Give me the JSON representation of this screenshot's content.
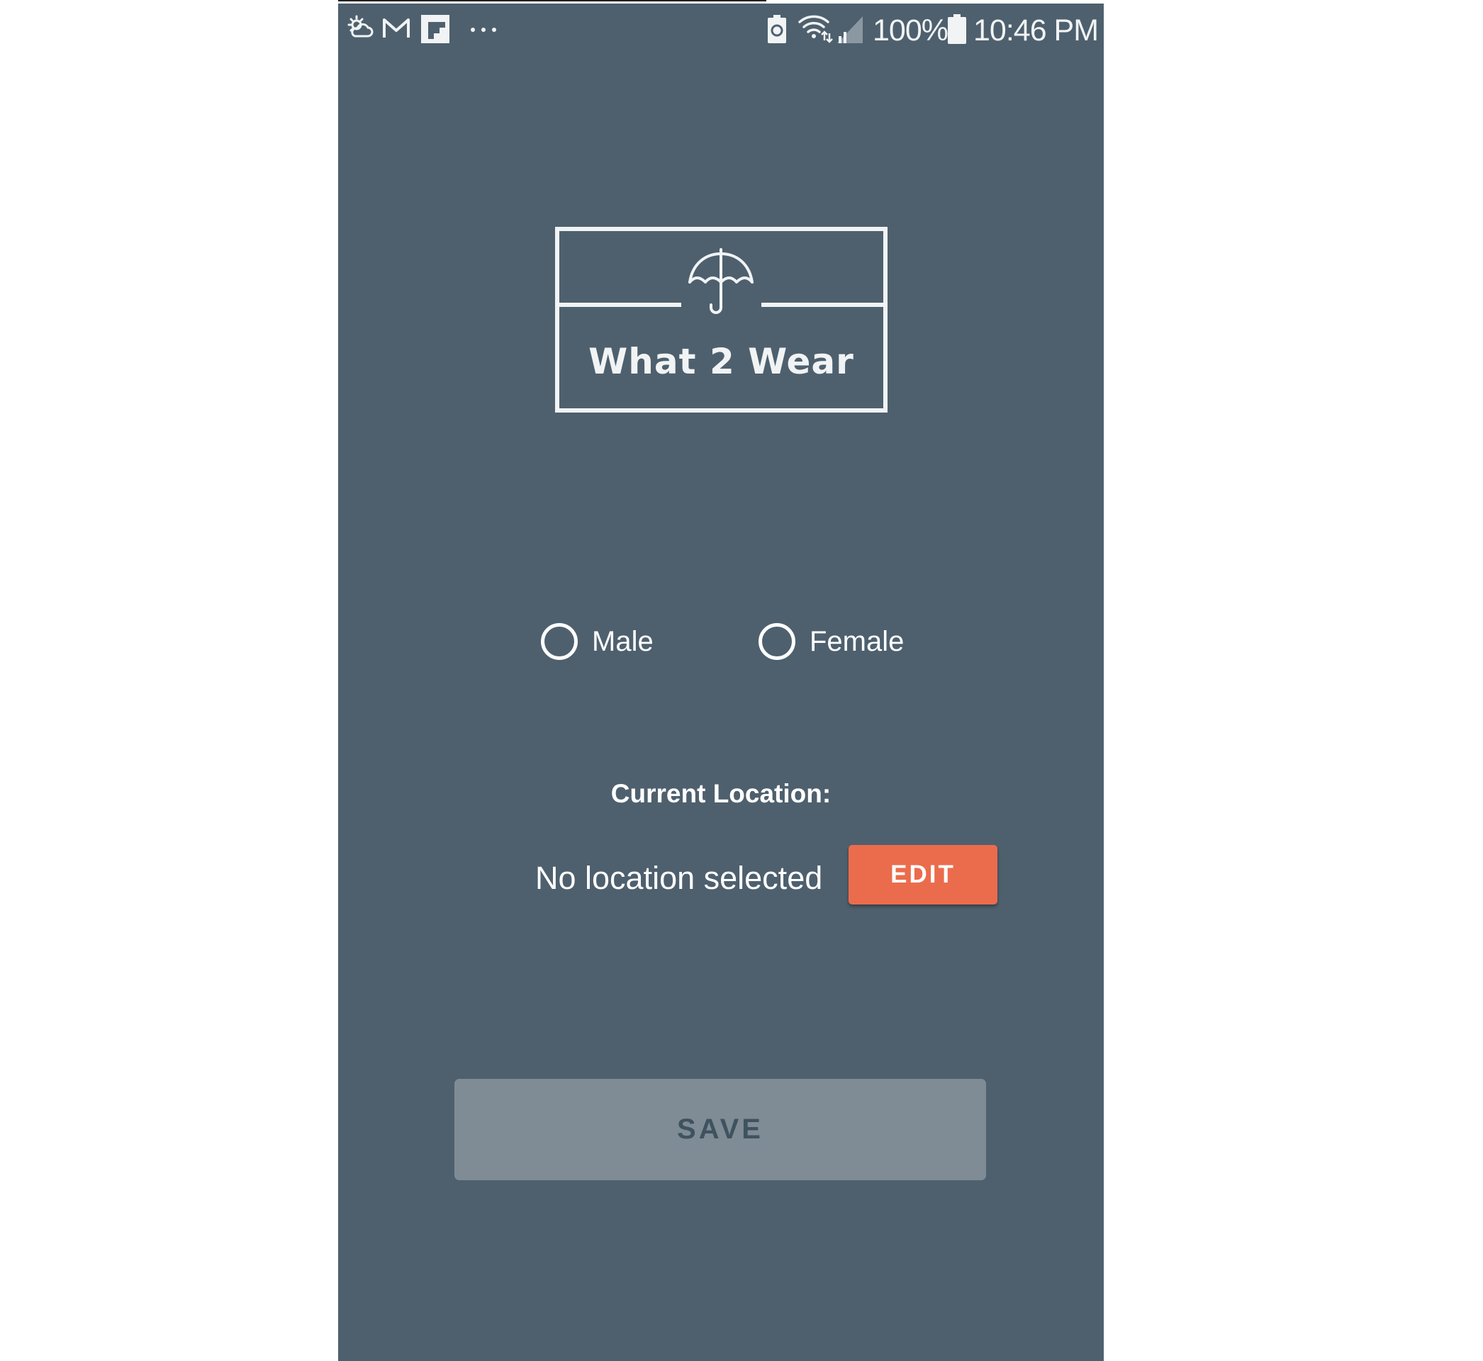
{
  "status_bar": {
    "icons": [
      "weather-cloud-icon",
      "gmail-icon",
      "flipboard-icon",
      "more-notifications-icon",
      "battery-saver-icon",
      "wifi-icon",
      "cell-signal-icon",
      "battery-icon"
    ],
    "battery_percent": "100%",
    "time": "10:46 PM"
  },
  "logo": {
    "title": "What 2 Wear",
    "icon": "umbrella-icon"
  },
  "gender": {
    "options": [
      {
        "label": "Male",
        "selected": false
      },
      {
        "label": "Female",
        "selected": false
      }
    ]
  },
  "location": {
    "heading": "Current Location:",
    "value": "No location selected",
    "edit_label": "EDIT"
  },
  "actions": {
    "save_label": "SAVE"
  },
  "colors": {
    "background": "#4e606e",
    "accent": "#eb6c4c",
    "save_button_bg": "#808c95",
    "save_button_text": "#3f5260",
    "foreground": "#ffffff"
  }
}
